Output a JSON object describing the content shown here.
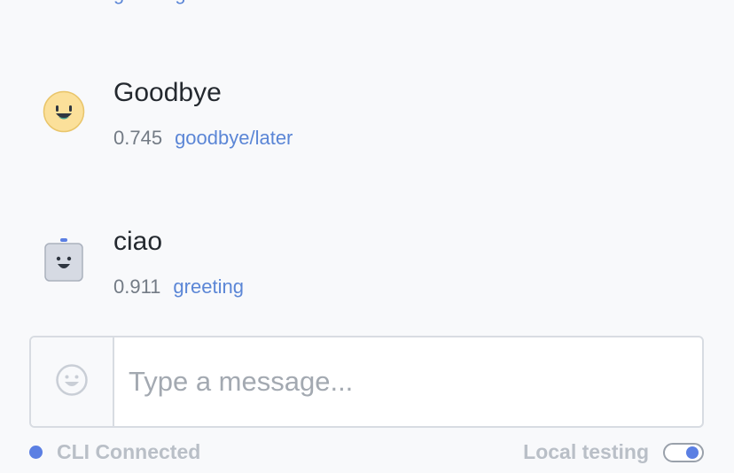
{
  "conversation": {
    "partial_top_text": "greeting",
    "messages": [
      {
        "text": "Goodbye",
        "score": "0.745",
        "intent": "goodbye/later",
        "avatar": "happy-face-icon"
      },
      {
        "text": "ciao",
        "score": "0.911",
        "intent": "greeting",
        "avatar": "robot-face-icon"
      }
    ]
  },
  "composer": {
    "placeholder": "Type a message...",
    "emoji_icon": "smiley-icon"
  },
  "status": {
    "cli_label": "CLI Connected",
    "local_testing_label": "Local testing",
    "local_testing_on": true
  },
  "colors": {
    "accent": "#5b7fe3",
    "link": "#5b86d6",
    "text": "#24292f",
    "muted": "#737b85",
    "background": "#f8f9fb"
  }
}
